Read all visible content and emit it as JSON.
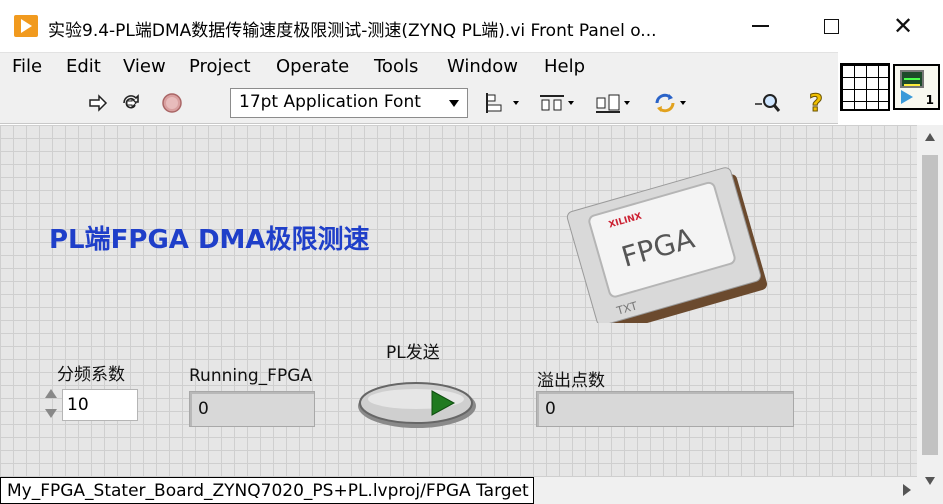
{
  "window": {
    "title": "实验9.4-PL端DMA数据传输速度极限测试-测速(ZYNQ PL端).vi Front Panel o...",
    "minimize_icon": "minimize-icon",
    "maximize_icon": "maximize-icon",
    "close_glyph": "✕"
  },
  "menu": {
    "items": [
      "File",
      "Edit",
      "View",
      "Project",
      "Operate",
      "Tools",
      "Window",
      "Help"
    ]
  },
  "toolbar": {
    "font": "17pt Application Font",
    "icons": [
      "run-arrow-icon",
      "run-continuously-icon",
      "abort-icon",
      "align-objects-icon",
      "distribute-objects-icon",
      "resize-objects-icon",
      "reorder-icon",
      "search-icon",
      "context-help-icon"
    ]
  },
  "vi_icon": {
    "number": "1"
  },
  "panel": {
    "title": "PL端FPGA DMA极限测速",
    "chip_label": "FPGA",
    "chip_brand": "XILINX",
    "chip_sub": "TXT",
    "divider_control": {
      "label": "分频系数",
      "value": "10"
    },
    "running_indicator": {
      "label": "Running_FPGA",
      "value": "0"
    },
    "send_button": {
      "label": "PL发送"
    },
    "overflow_indicator": {
      "label": "溢出点数",
      "value": "0"
    }
  },
  "status": {
    "path": "My_FPGA_Stater_Board_ZYNQ7020_PS+PL.lvproj/FPGA Target"
  },
  "colors": {
    "title_blue": "#1f3fc9",
    "labview_orange": "#f19a1e",
    "led_green": "#1f7a1f"
  }
}
